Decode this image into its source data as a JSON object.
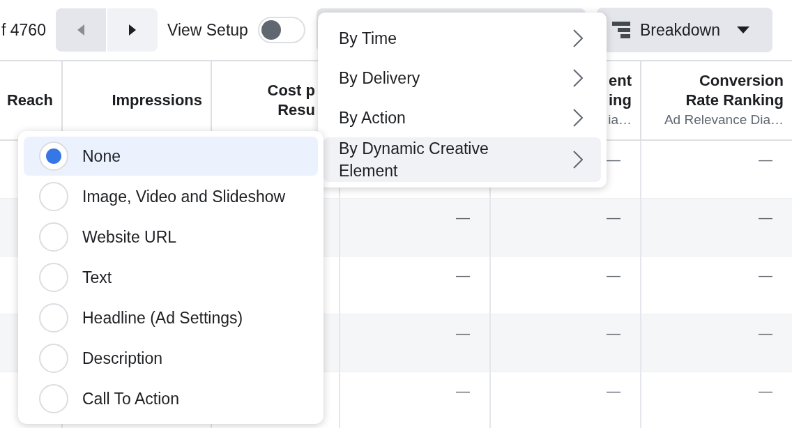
{
  "toolbar": {
    "page_count": "f 4760",
    "view_setup": {
      "label": "View Setup",
      "on": false
    },
    "breakdown": "Breakdown"
  },
  "table": {
    "columns": [
      {
        "lines": [
          "Reach"
        ]
      },
      {
        "lines": [
          "Impressions"
        ]
      },
      {
        "lines": [
          "Cost p",
          "Resu"
        ]
      },
      {},
      {
        "lines": [
          "ent",
          "ing"
        ],
        "subtitle": "ia…"
      },
      {
        "lines": [
          "Conversion",
          "Rate Ranking"
        ],
        "subtitle": "Ad Relevance Dia…"
      }
    ],
    "rows": [
      {
        "column_5": "—",
        "column_6": "—"
      },
      {
        "column_4": "—",
        "column_5": "—",
        "column_6": "—"
      },
      {
        "column_4": "—",
        "column_5": "—",
        "column_6": "—"
      },
      {
        "column_4": "—",
        "column_5": "—",
        "column_6": "—"
      },
      {
        "column_4": "—",
        "column_5": "—",
        "column_6": "—"
      }
    ]
  },
  "breakdown_menu": {
    "items": [
      {
        "label": "By Time",
        "selected": false
      },
      {
        "label": "By Delivery",
        "selected": false
      },
      {
        "label": "By Action",
        "selected": false
      },
      {
        "label": "By Dynamic Creative Element",
        "selected": true
      }
    ]
  },
  "creative_menu": {
    "options": [
      {
        "label": "None",
        "selected": true
      },
      {
        "label": "Image, Video and Slideshow",
        "selected": false
      },
      {
        "label": "Website URL",
        "selected": false
      },
      {
        "label": "Text",
        "selected": false
      },
      {
        "label": "Headline (Ad Settings)",
        "selected": false
      },
      {
        "label": "Description",
        "selected": false
      },
      {
        "label": "Call To Action",
        "selected": false
      }
    ]
  }
}
